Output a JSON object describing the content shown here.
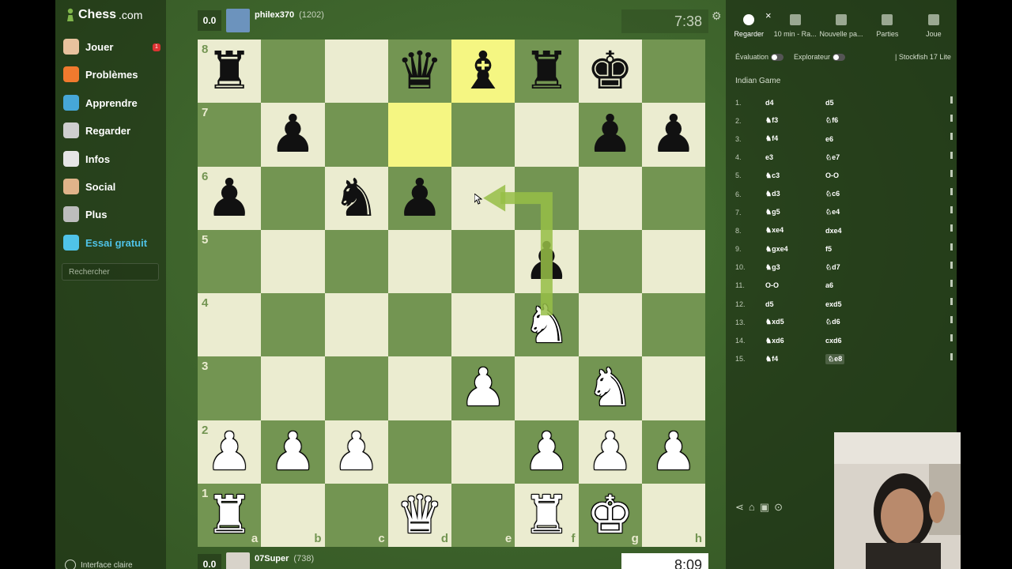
{
  "sidebar": {
    "logo_text": "Chess",
    "logo_suffix": ".com",
    "items": [
      {
        "label": "Jouer",
        "icon": "play-icon",
        "color": "#e8c39e"
      },
      {
        "label": "Problèmes",
        "icon": "puzzle-icon",
        "color": "#f07a2e"
      },
      {
        "label": "Apprendre",
        "icon": "learn-icon",
        "color": "#46a7d8"
      },
      {
        "label": "Regarder",
        "icon": "binoculars-icon",
        "color": "#cfcfcf"
      },
      {
        "label": "Infos",
        "icon": "news-icon",
        "color": "#e6e6e6"
      },
      {
        "label": "Social",
        "icon": "social-icon",
        "color": "#e0b48a"
      },
      {
        "label": "Plus",
        "icon": "more-icon",
        "color": "#bdbdbd"
      },
      {
        "label": "Essai gratuit",
        "icon": "diamond-icon",
        "color": "#4fc3e8"
      }
    ],
    "badge": "1",
    "search_placeholder": "Rechercher",
    "theme_label": "Interface claire"
  },
  "top_player": {
    "score": "0.0",
    "name": "philex370",
    "rating": "(1202)"
  },
  "bottom_player": {
    "score": "0.0",
    "name": "07Super",
    "rating": "(738)"
  },
  "clocks": {
    "top": "7:38",
    "bottom": "8:09"
  },
  "board": {
    "ranks": [
      "8",
      "7",
      "6",
      "5",
      "4",
      "3",
      "2",
      "1"
    ],
    "files": [
      "a",
      "b",
      "c",
      "d",
      "e",
      "f",
      "g",
      "h"
    ],
    "pieces": {
      "a8": "br",
      "d8": "bq",
      "e8": "bb",
      "f8": "br",
      "g8": "bk",
      "b7": "bp",
      "g7": "bp",
      "h7": "bp",
      "a6": "bp",
      "c6": "bn",
      "d6": "bp",
      "f5": "bp",
      "f4": "wn",
      "e3": "wp",
      "g3": "wn",
      "a2": "wp",
      "b2": "wp",
      "c2": "wp",
      "f2": "wp",
      "g2": "wp",
      "h2": "wp",
      "a1": "wr",
      "d1": "wq",
      "f1": "wr",
      "g1": "wk"
    },
    "highlight": [
      "d7",
      "e8"
    ],
    "arrow": {
      "from": "f4",
      "to": "e6"
    }
  },
  "panel": {
    "tabs": [
      {
        "label": "Regarder",
        "icon": "stopwatch-icon"
      },
      {
        "label": "10 min - Ra...",
        "icon": "medal-icon"
      },
      {
        "label": "Nouvelle pa...",
        "icon": "plus-icon"
      },
      {
        "label": "Parties",
        "icon": "board-icon"
      },
      {
        "label": "Joue",
        "icon": "user-icon"
      }
    ],
    "close": "×",
    "evaluation_label": "Évaluation",
    "explorer_label": "Explorateur",
    "engine_label": "| Stockfish 17 Lite",
    "opening": "Indian Game",
    "moves": [
      [
        "1.",
        "d4",
        "d5"
      ],
      [
        "2.",
        "♞f3",
        "♘f6"
      ],
      [
        "3.",
        "♞f4",
        "e6"
      ],
      [
        "4.",
        "e3",
        "♘e7"
      ],
      [
        "5.",
        "♞c3",
        "O-O"
      ],
      [
        "6.",
        "♞d3",
        "♘c6"
      ],
      [
        "7.",
        "♞g5",
        "♘e4"
      ],
      [
        "8.",
        "♞xe4",
        "dxe4"
      ],
      [
        "9.",
        "♞gxe4",
        "f5"
      ],
      [
        "10.",
        "♞g3",
        "♘d7"
      ],
      [
        "11.",
        "O-O",
        "a6"
      ],
      [
        "12.",
        "d5",
        "exd5"
      ],
      [
        "13.",
        "♞xd5",
        "♘d6"
      ],
      [
        "14.",
        "♞xd6",
        "cxd6"
      ],
      [
        "15.",
        "♞f4",
        "♘e8"
      ]
    ]
  }
}
